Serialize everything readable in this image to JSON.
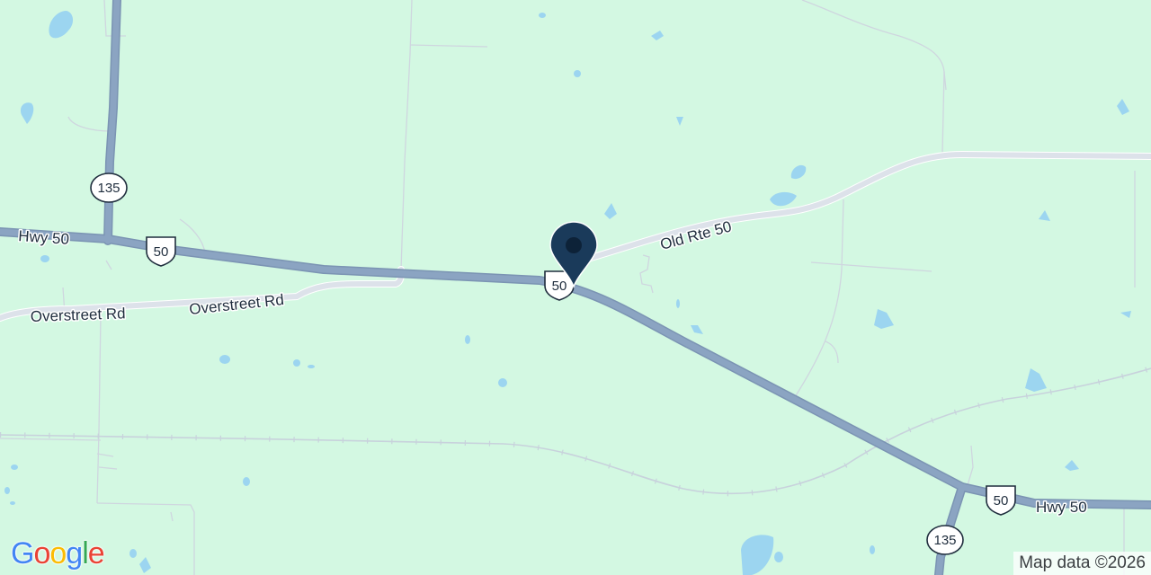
{
  "map": {
    "road_labels": {
      "hwy50_west": "Hwy 50",
      "hwy50_east": "Hwy 50",
      "old_rte_50": "Old Rte 50",
      "overstreet_west": "Overstreet Rd",
      "overstreet_east": "Overstreet Rd"
    },
    "shields": {
      "us50_west": "50",
      "us50_center": "50",
      "us50_east": "50",
      "sr135_north": "135",
      "sr135_south": "135"
    },
    "colors": {
      "land": "#d3f8e2",
      "water": "#9cd5f0",
      "highway": "#8ba4c2",
      "minor_road": "#dde2ea",
      "marker": "#1a3a5a"
    }
  },
  "branding": {
    "logo_letters": [
      "G",
      "o",
      "o",
      "g",
      "l",
      "e"
    ],
    "logo_colors": [
      "#4285F4",
      "#EA4335",
      "#FBBC05",
      "#4285F4",
      "#34A853",
      "#EA4335"
    ],
    "attribution": "Map data ©2026"
  }
}
